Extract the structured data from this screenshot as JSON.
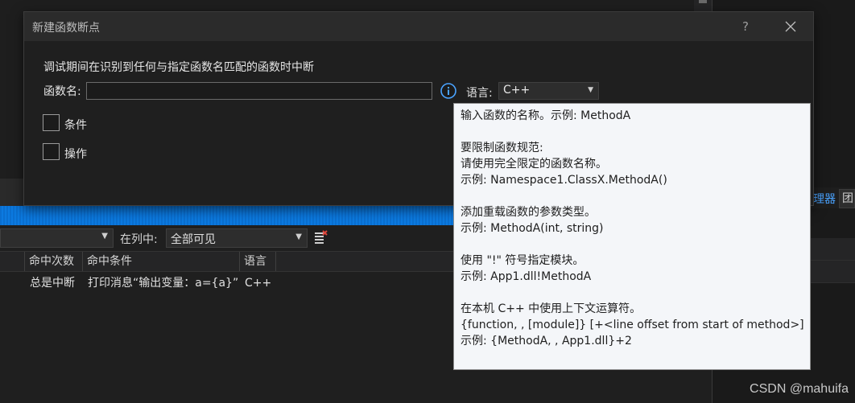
{
  "dialog": {
    "title": "新建函数断点",
    "help_label": "?",
    "description": "调试期间在识别到任何与指定函数名匹配的函数时中断",
    "function_name_label": "函数名:",
    "function_name_value": "",
    "language_label": "语言:",
    "language_value": "C++",
    "condition_label": "条件",
    "action_label": "操作"
  },
  "tooltip": {
    "lines": [
      "输入函数的名称。示例: MethodA",
      "",
      "要限制函数规范:",
      "请使用完全限定的函数名称。",
      "示例: Namespace1.ClassX.MethodA()",
      "",
      "添加重载函数的参数类型。",
      "示例: MethodA(int, string)",
      "",
      "使用 \"!\" 符号指定模块。",
      "示例: App1.dll!MethodA",
      "",
      "在本机 C++ 中使用上下文运算符。",
      "{function, , [module]} [+<line offset from start of method>]",
      "示例: {MethodA, , App1.dll}+2"
    ]
  },
  "breakpoints_window": {
    "in_column_label": "在列中:",
    "visible_filter_value": "全部可见",
    "columns": [
      "命中次数",
      "命中条件",
      "语言"
    ],
    "rows": [
      {
        "hit_count": "总是中断",
        "hit_condition": "打印消息“输出变量：a={a}”",
        "language": "C++"
      }
    ]
  },
  "right_panel": {
    "tab1_label": "理器",
    "tab2_label": "团"
  },
  "watermark": "CSDN @mahuifa",
  "colors": {
    "accent_blue": "#0c7ae0",
    "info_icon": "#4aa3ff",
    "tooltip_bg": "#f4f6f9"
  }
}
